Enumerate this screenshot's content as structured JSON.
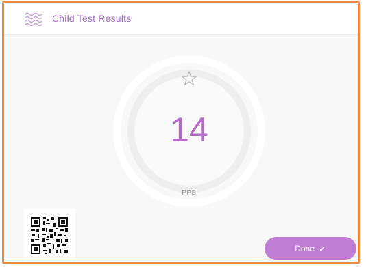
{
  "header": {
    "title": "Child Test Results",
    "icon": "waves-icon"
  },
  "result": {
    "value": "14",
    "unit": "PPB",
    "status_icon": "star-outline-icon"
  },
  "qr_code": {
    "icon": "qr-code-icon"
  },
  "actions": {
    "done_label": "Done",
    "done_icon": "checkmark-icon"
  },
  "colors": {
    "accent": "#b569c9",
    "button": "#c07fd4",
    "frame_border": "#f08a3c"
  }
}
